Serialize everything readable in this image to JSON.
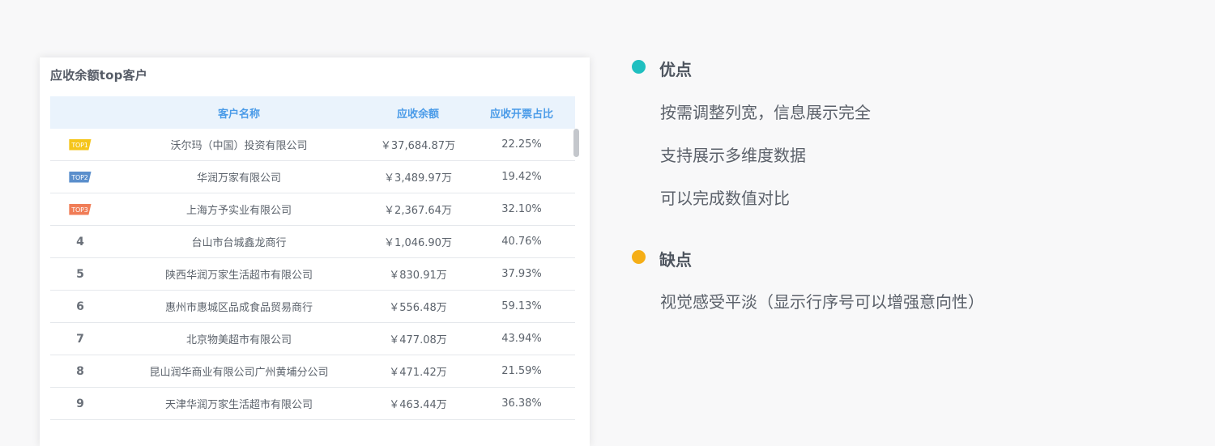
{
  "card": {
    "title": "应收余额top客户",
    "columns": [
      "",
      "客户名称",
      "应收余额",
      "应收开票占比"
    ],
    "rows": [
      {
        "rank": "TOP1",
        "badge_color": "#f5c51a",
        "name": "沃尔玛（中国）投资有限公司",
        "amount": "￥37,684.87万",
        "ratio": "22.25%"
      },
      {
        "rank": "TOP2",
        "badge_color": "#5b8fcc",
        "name": "华润万家有限公司",
        "amount": "￥3,489.97万",
        "ratio": "19.42%"
      },
      {
        "rank": "TOP3",
        "badge_color": "#f07d57",
        "name": "上海方予实业有限公司",
        "amount": "￥2,367.64万",
        "ratio": "32.10%"
      },
      {
        "rank": "4",
        "name": "台山市台城鑫龙商行",
        "amount": "￥1,046.90万",
        "ratio": "40.76%"
      },
      {
        "rank": "5",
        "name": "陕西华润万家生活超市有限公司",
        "amount": "￥830.91万",
        "ratio": "37.93%"
      },
      {
        "rank": "6",
        "name": "惠州市惠城区品成食品贸易商行",
        "amount": "￥556.48万",
        "ratio": "59.13%"
      },
      {
        "rank": "7",
        "name": "北京物美超市有限公司",
        "amount": "￥477.08万",
        "ratio": "43.94%"
      },
      {
        "rank": "8",
        "name": "昆山润华商业有限公司广州黄埔分公司",
        "amount": "￥471.42万",
        "ratio": "21.59%"
      },
      {
        "rank": "9",
        "name": "天津华润万家生活超市有限公司",
        "amount": "￥463.44万",
        "ratio": "36.38%"
      }
    ]
  },
  "pros": {
    "title": "优点",
    "dot_color": "#1fbfc0",
    "points": [
      "按需调整列宽，信息展示完全",
      "支持展示多维度数据",
      "可以完成数值对比"
    ]
  },
  "cons": {
    "title": "缺点",
    "dot_color": "#f5ae17",
    "points": [
      "视觉感受平淡（显示行序号可以增强意向性）"
    ]
  }
}
